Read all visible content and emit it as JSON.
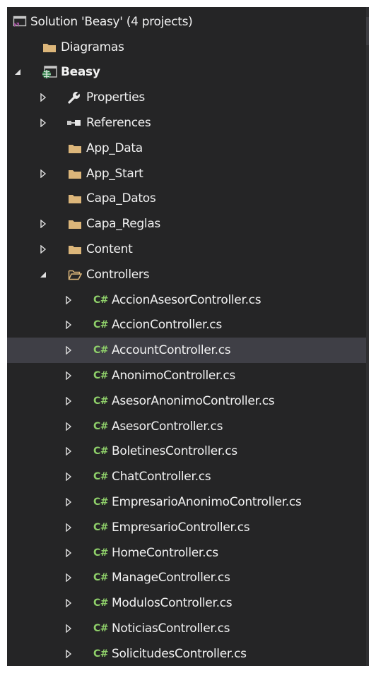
{
  "solution": {
    "label": "Solution 'Beasy' (4 projects)"
  },
  "nodes": {
    "diagramas": "Diagramas",
    "beasy": "Beasy",
    "properties": "Properties",
    "references": "References",
    "app_data": "App_Data",
    "app_start": "App_Start",
    "capa_datos": "Capa_Datos",
    "capa_reglas": "Capa_Reglas",
    "content": "Content",
    "controllers": "Controllers"
  },
  "cs_badge": "C#",
  "controller_files": [
    "AccionAsesorController.cs",
    "AccionController.cs",
    "AccountController.cs",
    "AnonimoController.cs",
    "AsesorAnonimoController.cs",
    "AsesorController.cs",
    "BoletinesController.cs",
    "ChatController.cs",
    "EmpresarioAnonimoController.cs",
    "EmpresarioController.cs",
    "HomeController.cs",
    "ManageController.cs",
    "ModulosController.cs",
    "NoticiasController.cs",
    "SolicitudesController.cs"
  ],
  "selected_file": "AccountController.cs",
  "colors": {
    "background": "#252526",
    "text": "#f1f1f1",
    "selection": "#3f3f46",
    "folder": "#dcb67a",
    "csharp": "#8fd06a",
    "solution_icon": "#9b4f96"
  }
}
